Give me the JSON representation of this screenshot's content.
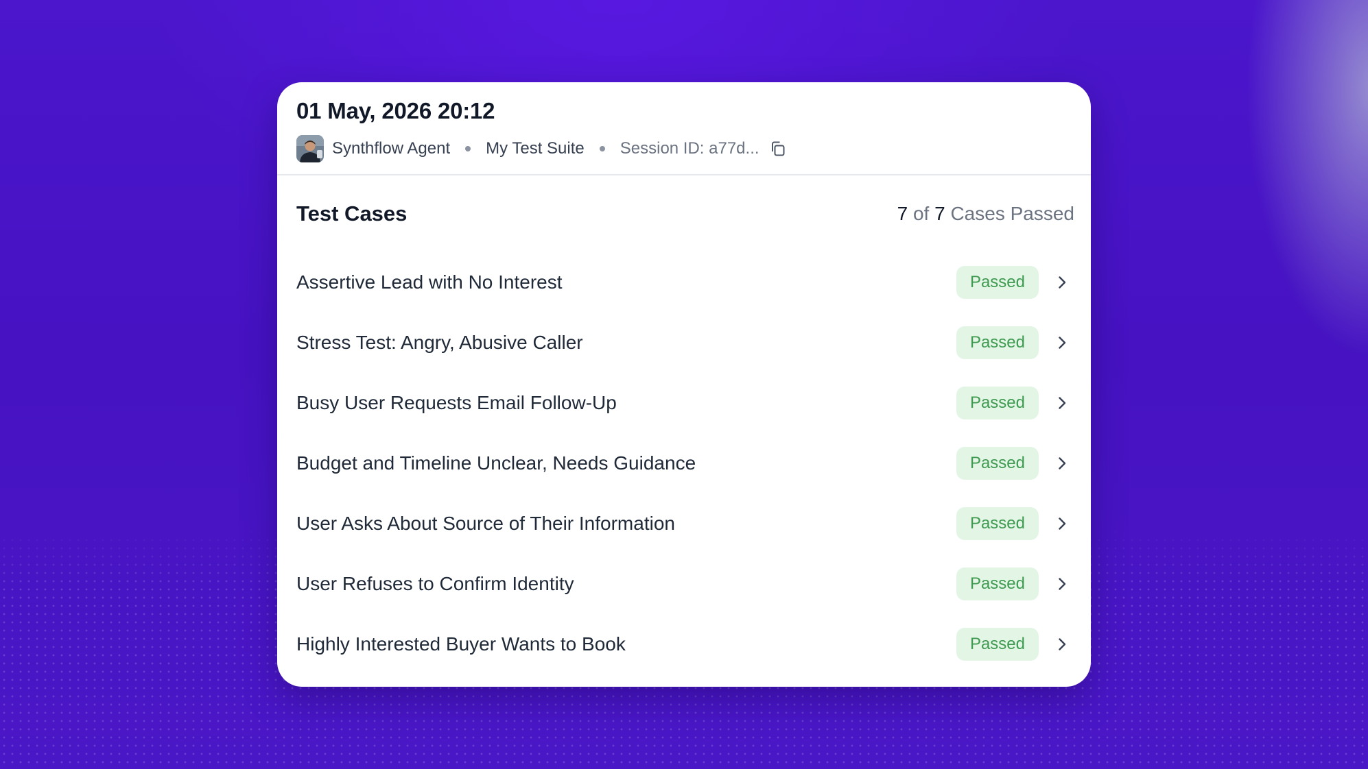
{
  "header": {
    "date": "01 May, 2026 20:12",
    "agent_name": "Synthflow Agent",
    "suite_name": "My Test Suite",
    "session_label": "Session ID: a77d...",
    "icons": [
      "avatar",
      "copy-icon"
    ]
  },
  "test_cases": {
    "title": "Test Cases",
    "summary": {
      "passed": "7",
      "of": "of",
      "total": "7",
      "label": "Cases Passed"
    },
    "items": [
      {
        "title": "Assertive Lead with No Interest",
        "status": "Passed"
      },
      {
        "title": "Stress Test: Angry, Abusive Caller",
        "status": "Passed"
      },
      {
        "title": "Busy User Requests Email Follow-Up",
        "status": "Passed"
      },
      {
        "title": "Budget and Timeline Unclear, Needs Guidance",
        "status": "Passed"
      },
      {
        "title": "User Asks About Source of Their Information",
        "status": "Passed"
      },
      {
        "title": "User Refuses to Confirm Identity",
        "status": "Passed"
      },
      {
        "title": "Highly Interested Buyer Wants to Book",
        "status": "Passed"
      }
    ]
  },
  "colors": {
    "background": "#4a14c8",
    "card": "#ffffff",
    "passed_badge_bg": "#e3f6e6",
    "passed_badge_text": "#3e9a50"
  }
}
